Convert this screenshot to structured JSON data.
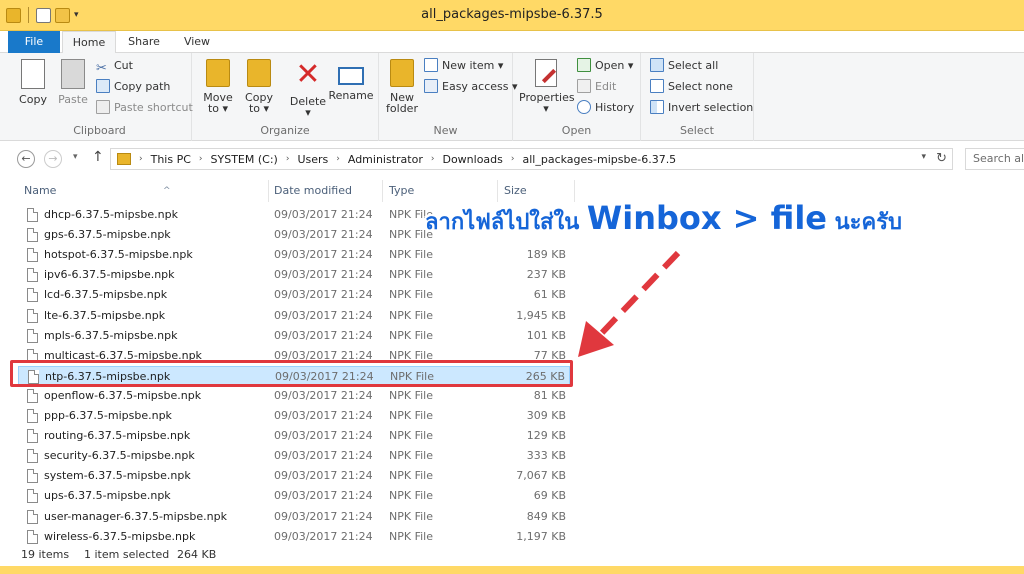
{
  "window": {
    "title": "all_packages-mipsbe-6.37.5"
  },
  "tabs": [
    "File",
    "Home",
    "Share",
    "View"
  ],
  "ribbon": {
    "clipboard": {
      "label": "Clipboard",
      "copy": "Copy",
      "paste": "Paste",
      "cut": "Cut",
      "copy_path": "Copy path",
      "paste_shortcut": "Paste shortcut"
    },
    "organize": {
      "label": "Organize",
      "move_to_1": "Move",
      "move_to_2": "to ▾",
      "copy_to_1": "Copy",
      "copy_to_2": "to ▾",
      "delete": "Delete",
      "delete_arrow": "▾",
      "rename": "Rename"
    },
    "new": {
      "label": "New",
      "new_folder_1": "New",
      "new_folder_2": "folder",
      "new_item": "New item ▾",
      "easy_access": "Easy access ▾"
    },
    "open": {
      "label": "Open",
      "properties": "Properties",
      "properties_arrow": "▾",
      "open": "Open ▾",
      "edit": "Edit",
      "history": "History"
    },
    "select": {
      "label": "Select",
      "select_all": "Select all",
      "select_none": "Select none",
      "invert_selection": "Invert selection"
    }
  },
  "address": {
    "breadcrumbs": [
      "This PC",
      "SYSTEM (C:)",
      "Users",
      "Administrator",
      "Downloads",
      "all_packages-mipsbe-6.37.5"
    ],
    "search_placeholder": "Search all_p..."
  },
  "columns": {
    "name": "Name",
    "date": "Date modified",
    "type": "Type",
    "size": "Size"
  },
  "files": [
    {
      "name": "dhcp-6.37.5-mipsbe.npk",
      "date": "09/03/2017 21:24",
      "type": "NPK File",
      "size": ""
    },
    {
      "name": "gps-6.37.5-mipsbe.npk",
      "date": "09/03/2017 21:24",
      "type": "NPK File",
      "size": ""
    },
    {
      "name": "hotspot-6.37.5-mipsbe.npk",
      "date": "09/03/2017 21:24",
      "type": "NPK File",
      "size": "189 KB"
    },
    {
      "name": "ipv6-6.37.5-mipsbe.npk",
      "date": "09/03/2017 21:24",
      "type": "NPK File",
      "size": "237 KB"
    },
    {
      "name": "lcd-6.37.5-mipsbe.npk",
      "date": "09/03/2017 21:24",
      "type": "NPK File",
      "size": "61 KB"
    },
    {
      "name": "lte-6.37.5-mipsbe.npk",
      "date": "09/03/2017 21:24",
      "type": "NPK File",
      "size": "1,945 KB"
    },
    {
      "name": "mpls-6.37.5-mipsbe.npk",
      "date": "09/03/2017 21:24",
      "type": "NPK File",
      "size": "101 KB"
    },
    {
      "name": "multicast-6.37.5-mipsbe.npk",
      "date": "09/03/2017 21:24",
      "type": "NPK File",
      "size": "77 KB"
    },
    {
      "name": "ntp-6.37.5-mipsbe.npk",
      "date": "09/03/2017 21:24",
      "type": "NPK File",
      "size": "265 KB"
    },
    {
      "name": "openflow-6.37.5-mipsbe.npk",
      "date": "09/03/2017 21:24",
      "type": "NPK File",
      "size": "81 KB"
    },
    {
      "name": "ppp-6.37.5-mipsbe.npk",
      "date": "09/03/2017 21:24",
      "type": "NPK File",
      "size": "309 KB"
    },
    {
      "name": "routing-6.37.5-mipsbe.npk",
      "date": "09/03/2017 21:24",
      "type": "NPK File",
      "size": "129 KB"
    },
    {
      "name": "security-6.37.5-mipsbe.npk",
      "date": "09/03/2017 21:24",
      "type": "NPK File",
      "size": "333 KB"
    },
    {
      "name": "system-6.37.5-mipsbe.npk",
      "date": "09/03/2017 21:24",
      "type": "NPK File",
      "size": "7,067 KB"
    },
    {
      "name": "ups-6.37.5-mipsbe.npk",
      "date": "09/03/2017 21:24",
      "type": "NPK File",
      "size": "69 KB"
    },
    {
      "name": "user-manager-6.37.5-mipsbe.npk",
      "date": "09/03/2017 21:24",
      "type": "NPK File",
      "size": "849 KB"
    },
    {
      "name": "wireless-6.37.5-mipsbe.npk",
      "date": "09/03/2017 21:24",
      "type": "NPK File",
      "size": "1,197 KB"
    }
  ],
  "selected_index": 8,
  "annotation": {
    "part1": "ลากไฟล์ไปใส่ใน ",
    "part2": "Winbox > file",
    "part3": " นะครับ",
    "color": "#1565d8",
    "arrow_color": "#e0383e"
  },
  "status": {
    "items": "19 items",
    "selected": "1 item selected",
    "selected_size": "264 KB"
  },
  "colors": {
    "titlebar": "#ffd966",
    "file_tab": "#1979ca",
    "selection": "#cce8ff",
    "highlight": "#e0383e"
  }
}
